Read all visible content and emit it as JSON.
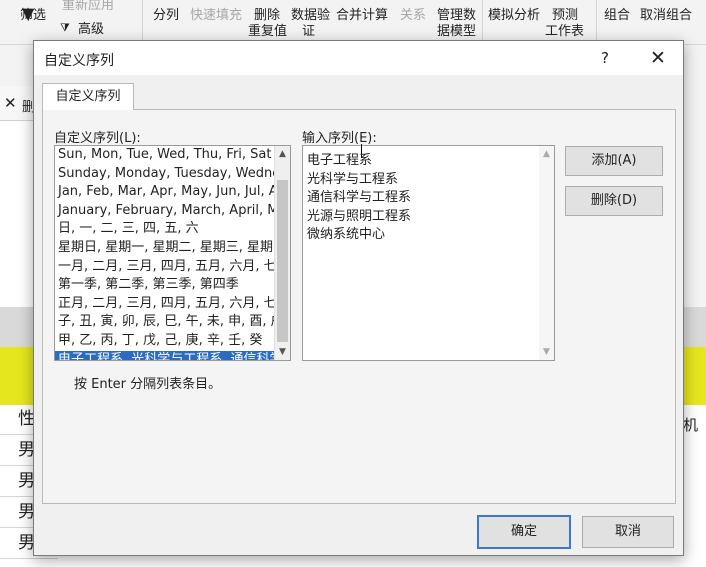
{
  "ribbon": {
    "filter": "筛选",
    "reapply": "重新应用",
    "advanced": "高级",
    "split": "分列",
    "flash_fill": "快速填充",
    "remove_dup_1": "删除",
    "remove_dup_2": "重复值",
    "validation_1": "数据验",
    "validation_2": "证",
    "consolidate": "合并计算",
    "relations": "关系",
    "data_model_1": "管理数",
    "data_model_2": "据模型",
    "what_if": "模拟分析",
    "forecast_1": "预测",
    "forecast_2": "工作表",
    "group": "组合",
    "ungroup": "取消组合"
  },
  "background": {
    "delete_stub": "删",
    "col_label": "性",
    "col_label_right": "机",
    "rows": [
      "男",
      "男",
      "男",
      "男"
    ]
  },
  "dialog": {
    "title": "自定义序列",
    "help": "?",
    "close": "✕",
    "tab": "自定义序列",
    "left_label": "自定义序列(L):",
    "right_label": "输入序列(E):",
    "list": [
      "Sun, Mon, Tue, Wed, Thu, Fri, Sat",
      "Sunday, Monday, Tuesday, Wednesday",
      "Jan, Feb, Mar, Apr, May, Jun, Jul, Aug",
      "January, February, March, April, May",
      "日, 一, 二, 三, 四, 五, 六",
      "星期日, 星期一, 星期二, 星期三, 星期四",
      "一月, 二月, 三月, 四月, 五月, 六月, 七月",
      "第一季, 第二季, 第三季, 第四季",
      "正月, 二月, 三月, 四月, 五月, 六月, 七月",
      "子, 丑, 寅, 卯, 辰, 巳, 午, 未, 申, 酉, 戌",
      "甲, 乙, 丙, 丁, 戊, 己, 庚, 辛, 壬, 癸",
      "电子工程系, 光科学与工程系, 通信科学与工程系"
    ],
    "entries": [
      "电子工程系",
      "光科学与工程系",
      "通信科学与工程系",
      "光源与照明工程系",
      "微纳系统中心"
    ],
    "add": "添加(A)",
    "delete": "删除(D)",
    "hint": "按 Enter 分隔列表条目。",
    "ok": "确定",
    "cancel": "取消"
  }
}
